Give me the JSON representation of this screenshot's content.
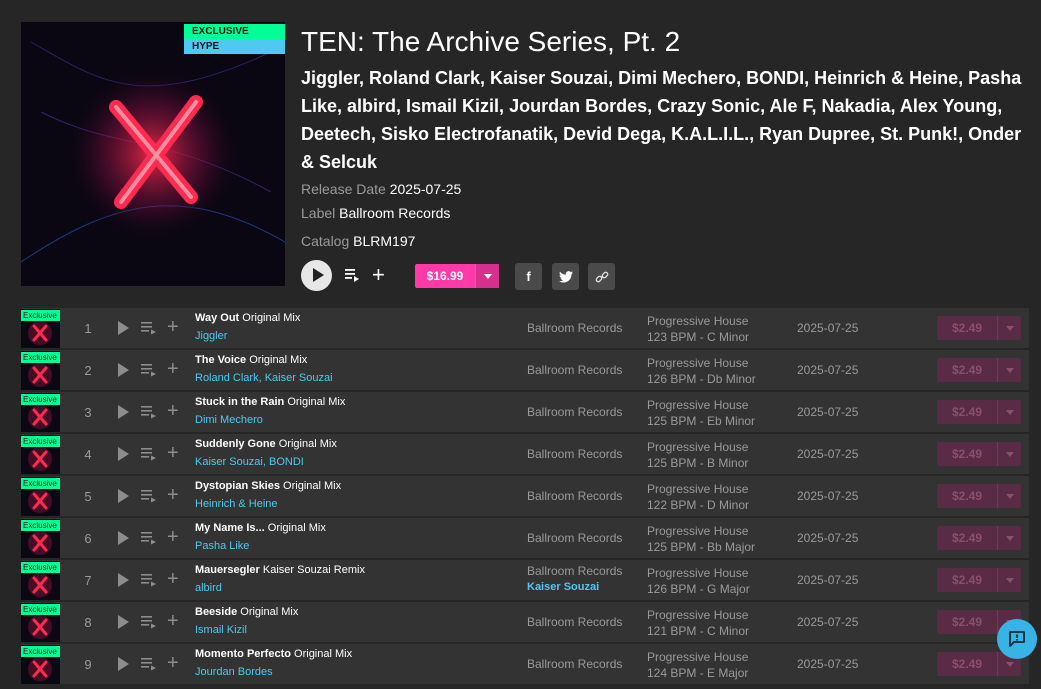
{
  "release": {
    "badge_exclusive": "EXCLUSIVE",
    "badge_hype": "HYPE",
    "title": "TEN: The Archive Series, Pt. 2",
    "artists": "Jiggler, Roland Clark, Kaiser Souzai, Dimi Mechero, BONDI, Heinrich & Heine, Pasha Like, albird, Ismail Kizil, Jourdan Bordes, Crazy Sonic, Ale F, Nakadia, Alex Young, Deetech, Sisko Electrofanatik, Devid Dega, K.A.L.I.L., Ryan Dupree, St. Punk!, Onder & Selcuk",
    "release_date_label": "Release Date",
    "release_date": "2025-07-25",
    "label_label": "Label",
    "label": "Ballroom Records",
    "catalog_label": "Catalog",
    "catalog": "BLRM197",
    "price": "$16.99"
  },
  "share": {
    "facebook": "f",
    "twitter": "t",
    "link": "∞"
  },
  "icons": [
    "play-icon",
    "queue-icon",
    "plus-icon",
    "facebook-icon",
    "twitter-icon",
    "link-icon",
    "chat-icon"
  ],
  "colors": {
    "accent_pink": "#ff3aa8",
    "exclusive_green": "#02ff95",
    "hype_blue": "#4fc9f0",
    "link_blue": "#4fc9f0"
  },
  "tracks": [
    {
      "num": "1",
      "exclusive": "Exclusive",
      "title": "Way Out",
      "mix": "Original Mix",
      "artist": "Jiggler",
      "label": "Ballroom Records",
      "remixer": "",
      "genre": "Progressive House",
      "bpm_key": "123 BPM - C Minor",
      "date": "2025-07-25",
      "price": "$2.49"
    },
    {
      "num": "2",
      "exclusive": "Exclusive",
      "title": "The Voice",
      "mix": "Original Mix",
      "artist": "Roland Clark, Kaiser Souzai",
      "label": "Ballroom Records",
      "remixer": "",
      "genre": "Progressive House",
      "bpm_key": "126 BPM - Db Minor",
      "date": "2025-07-25",
      "price": "$2.49"
    },
    {
      "num": "3",
      "exclusive": "Exclusive",
      "title": "Stuck in the Rain",
      "mix": "Original Mix",
      "artist": "Dimi Mechero",
      "label": "Ballroom Records",
      "remixer": "",
      "genre": "Progressive House",
      "bpm_key": "125 BPM - Eb Minor",
      "date": "2025-07-25",
      "price": "$2.49"
    },
    {
      "num": "4",
      "exclusive": "Exclusive",
      "title": "Suddenly Gone",
      "mix": "Original Mix",
      "artist": "Kaiser Souzai, BONDI",
      "label": "Ballroom Records",
      "remixer": "",
      "genre": "Progressive House",
      "bpm_key": "125 BPM - B Minor",
      "date": "2025-07-25",
      "price": "$2.49"
    },
    {
      "num": "5",
      "exclusive": "Exclusive",
      "title": "Dystopian Skies",
      "mix": "Original Mix",
      "artist": "Heinrich & Heine",
      "label": "Ballroom Records",
      "remixer": "",
      "genre": "Progressive House",
      "bpm_key": "122 BPM - D Minor",
      "date": "2025-07-25",
      "price": "$2.49"
    },
    {
      "num": "6",
      "exclusive": "Exclusive",
      "title": "My Name Is...",
      "mix": "Original Mix",
      "artist": "Pasha Like",
      "label": "Ballroom Records",
      "remixer": "",
      "genre": "Progressive House",
      "bpm_key": "125 BPM - Bb Major",
      "date": "2025-07-25",
      "price": "$2.49"
    },
    {
      "num": "7",
      "exclusive": "Exclusive",
      "title": "Mauersegler",
      "mix": "Kaiser Souzai Remix",
      "artist": "albird",
      "label": "Ballroom Records",
      "remixer": "Kaiser Souzai",
      "genre": "Progressive House",
      "bpm_key": "126 BPM - G Major",
      "date": "2025-07-25",
      "price": "$2.49"
    },
    {
      "num": "8",
      "exclusive": "Exclusive",
      "title": "Beeside",
      "mix": "Original Mix",
      "artist": "Ismail Kizil",
      "label": "Ballroom Records",
      "remixer": "",
      "genre": "Progressive House",
      "bpm_key": "121 BPM - C Minor",
      "date": "2025-07-25",
      "price": "$2.49"
    },
    {
      "num": "9",
      "exclusive": "Exclusive",
      "title": "Momento Perfecto",
      "mix": "Original Mix",
      "artist": "Jourdan Bordes",
      "label": "Ballroom Records",
      "remixer": "",
      "genre": "Progressive House",
      "bpm_key": "124 BPM - E Major",
      "date": "2025-07-25",
      "price": "$2.49"
    }
  ]
}
